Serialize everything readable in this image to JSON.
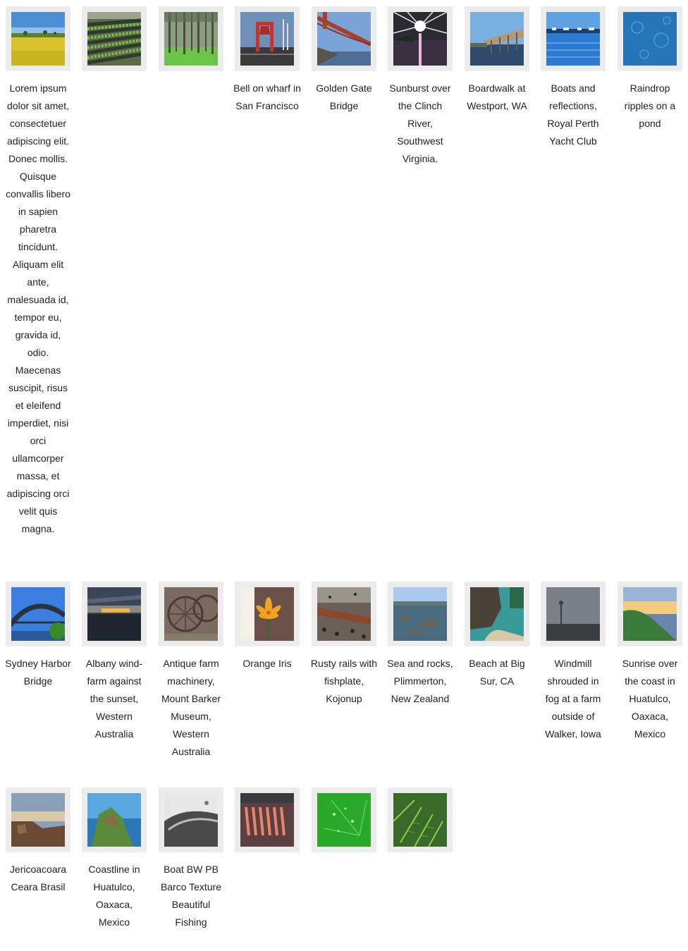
{
  "gallery": {
    "items": [
      {
        "caption": "Lorem ipsum dolor sit amet, consectetuer adipiscing elit. Donec mollis. Quisque convallis libero in sapien pharetra tincidunt. Aliquam elit ante, malesuada id, tempor eu, gravida id, odio. Maecenas suscipit, risus et eleifend imperdiet, nisi orci ullamcorper massa, et adipiscing orci velit quis magna.",
        "icon": "field-photo-icon"
      },
      {
        "caption": "",
        "icon": "crop-rows-photo-icon"
      },
      {
        "caption": "",
        "icon": "pine-forest-photo-icon"
      },
      {
        "caption": "Bell on wharf in San Francisco",
        "icon": "wharf-bell-photo-icon"
      },
      {
        "caption": "Golden Gate Bridge",
        "icon": "golden-gate-photo-icon"
      },
      {
        "caption": "Sunburst over the Clinch River, Southwest Virginia.",
        "icon": "sunburst-river-photo-icon"
      },
      {
        "caption": "Boardwalk at Westport, WA",
        "icon": "boardwalk-photo-icon"
      },
      {
        "caption": "Boats and reflections, Royal Perth Yacht Club",
        "icon": "boats-harbor-photo-icon"
      },
      {
        "caption": "Raindrop ripples on a pond",
        "icon": "raindrop-pond-photo-icon"
      },
      {
        "caption": "Sydney Harbor Bridge",
        "icon": "sydney-bridge-photo-icon"
      },
      {
        "caption": "Albany wind-farm against the sunset, Western Australia",
        "icon": "windfarm-sunset-photo-icon"
      },
      {
        "caption": "Antique farm machinery, Mount Barker Museum, Western Australia",
        "icon": "farm-machinery-photo-icon"
      },
      {
        "caption": "Orange Iris",
        "icon": "orange-iris-photo-icon"
      },
      {
        "caption": "Rusty rails with fishplate, Kojonup",
        "icon": "rusty-rails-photo-icon"
      },
      {
        "caption": "Sea and rocks, Plimmerton, New Zealand",
        "icon": "sea-rocks-photo-icon"
      },
      {
        "caption": "Beach at Big Sur, CA",
        "icon": "big-sur-beach-photo-icon"
      },
      {
        "caption": "Windmill shrouded in fog at a farm outside of Walker, Iowa",
        "icon": "foggy-windmill-photo-icon"
      },
      {
        "caption": "Sunrise over the coast in Huatulco, Oaxaca, Mexico",
        "icon": "coast-sunrise-photo-icon"
      },
      {
        "caption": "Jericoacoara Ceara Brasil",
        "icon": "jericoacoara-photo-icon"
      },
      {
        "caption": "Coastline in Huatulco, Oaxaca, Mexico",
        "icon": "coastline-photo-icon"
      },
      {
        "caption": "Boat BW PB Barco Texture Beautiful Fishing",
        "icon": "boat-bw-photo-icon"
      },
      {
        "caption": "",
        "icon": "fish-grill-photo-icon"
      },
      {
        "caption": "",
        "icon": "green-leaf-drops-photo-icon"
      },
      {
        "caption": "",
        "icon": "fern-photo-icon"
      }
    ]
  }
}
